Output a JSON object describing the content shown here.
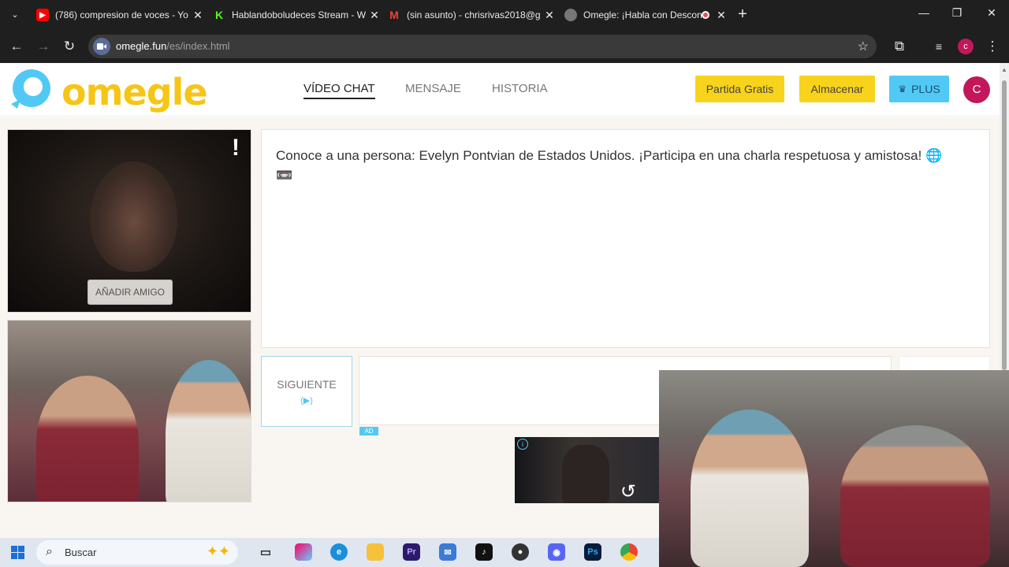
{
  "browser": {
    "tabs": [
      {
        "title": "(786) compresion de voces - Yo",
        "favicon": "youtube-icon",
        "color": "#ff0000"
      },
      {
        "title": "Hablandoboludeces Stream - W",
        "favicon": "kick-icon",
        "color": "#53fc18"
      },
      {
        "title": "(sin asunto) - chrisrivas2018@g",
        "favicon": "gmail-icon",
        "color": "#ea4335"
      },
      {
        "title": "Omegle: ¡Habla con Descon",
        "favicon": "globe-icon",
        "color": "#888888"
      }
    ],
    "url_host": "omegle.fun",
    "url_path": "/es/index.html",
    "profile_initial": "c"
  },
  "site": {
    "logo_text": "omegle",
    "nav": [
      {
        "label": "VÍDEO CHAT",
        "active": true
      },
      {
        "label": "MENSAJE",
        "active": false
      },
      {
        "label": "HISTORIA",
        "active": false
      }
    ],
    "buttons": {
      "partida": "Partida Gratis",
      "almacenar": "Almacenar",
      "plus": "PLUS"
    },
    "avatar_initial": "C"
  },
  "video": {
    "report_mark": "!",
    "add_friend": "AÑADIR AMIGO"
  },
  "chat": {
    "message": "Conoce a una persona: Evelyn Pontvian de Estados Unidos. ¡Participa en una charla respetuosa y amistosa! 🌐 📼",
    "next_label": "SIGUIENTE",
    "next_icon": "(▶)",
    "ad_label": "AD"
  },
  "taskbar": {
    "search_placeholder": "Buscar"
  },
  "colors": {
    "accent_yellow": "#f8d31c",
    "accent_blue": "#52c9f5",
    "avatar": "#c2185b"
  }
}
